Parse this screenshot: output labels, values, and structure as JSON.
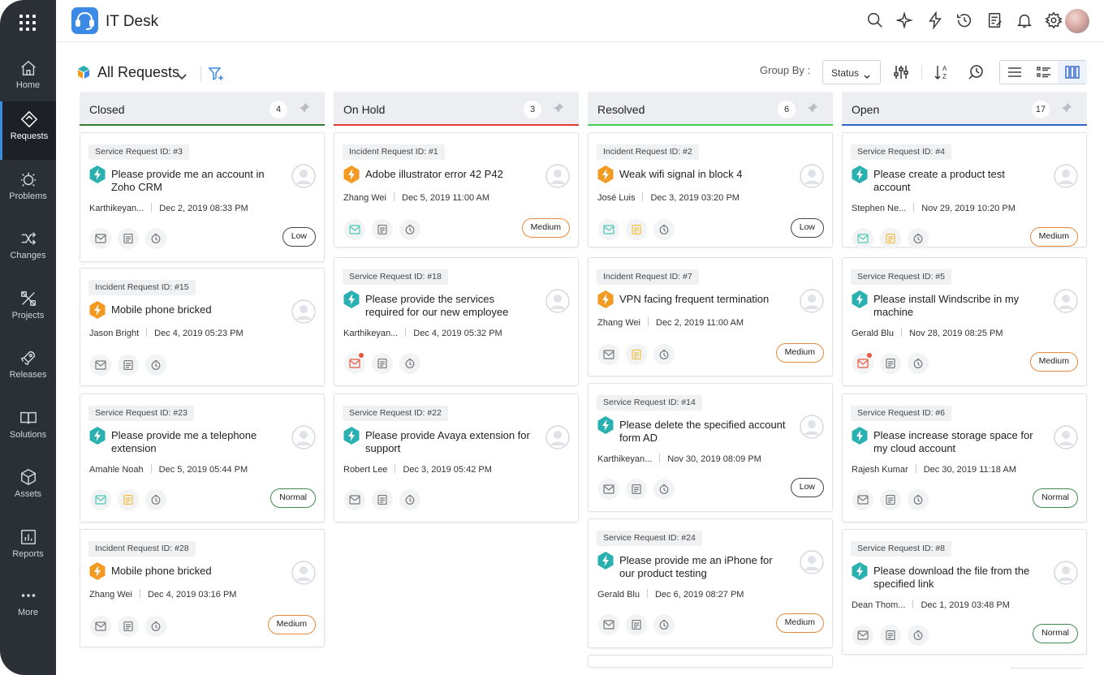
{
  "app": {
    "title": "IT Desk"
  },
  "sidebar": {
    "items": [
      {
        "label": "Home",
        "icon": "home-icon"
      },
      {
        "label": "Requests",
        "icon": "requests-icon"
      },
      {
        "label": "Problems",
        "icon": "problems-icon"
      },
      {
        "label": "Changes",
        "icon": "changes-icon"
      },
      {
        "label": "Projects",
        "icon": "projects-icon"
      },
      {
        "label": "Releases",
        "icon": "releases-icon"
      },
      {
        "label": "Solutions",
        "icon": "solutions-icon"
      },
      {
        "label": "Assets",
        "icon": "assets-icon"
      },
      {
        "label": "Reports",
        "icon": "reports-icon"
      },
      {
        "label": "More",
        "icon": "more-icon"
      }
    ]
  },
  "toolbar": {
    "view_title": "All Requests",
    "group_by_label": "Group By :",
    "group_by_value": "Status"
  },
  "colors": {
    "closed": "#2e7d32",
    "on_hold": "#e53935",
    "resolved": "#43d15a",
    "open": "#2f63c9",
    "service_icon": "#2ab0b0",
    "incident_icon": "#f29a22"
  },
  "columns": [
    {
      "title": "Closed",
      "count": "4",
      "cards": [
        {
          "type": "service",
          "id_label": "Service Request ID: #3",
          "subject": "Please provide me an account in Zoho CRM",
          "requester": "Karthikeyan...",
          "date": "Dec 2, 2019 08:33 PM",
          "priority": "Low",
          "mail": "gray",
          "note": "gray"
        },
        {
          "type": "incident",
          "id_label": "Incident Request ID: #15",
          "subject": "Mobile phone bricked",
          "requester": "Jason Bright",
          "date": "Dec 4, 2019 05:23 PM",
          "priority": "",
          "mail": "gray",
          "note": "gray"
        },
        {
          "type": "service",
          "id_label": "Service Request ID: #23",
          "subject": "Please provide me a telephone extension",
          "requester": "Amahle Noah",
          "date": "Dec 5, 2019 05:44 PM",
          "priority": "Normal",
          "mail": "teal",
          "note": "yellow"
        },
        {
          "type": "incident",
          "id_label": "Incident Request ID: #28",
          "subject": "Mobile phone bricked",
          "requester": "Zhang Wei",
          "date": "Dec 4, 2019 03:16 PM",
          "priority": "Medium",
          "mail": "gray",
          "note": "gray"
        }
      ]
    },
    {
      "title": "On Hold",
      "count": "3",
      "cards": [
        {
          "type": "incident",
          "id_label": "Incident Request ID: #1",
          "subject": "Adobe illustrator error 42 P42",
          "requester": "Zhang Wei",
          "date": "Dec 5, 2019 11:00 AM",
          "priority": "Medium",
          "mail": "teal",
          "note": "gray"
        },
        {
          "type": "service",
          "id_label": "Service Request ID: #18",
          "subject": "Please provide the services required for our new employee",
          "requester": "Karthikeyan...",
          "date": "Dec 4, 2019 05:32 PM",
          "priority": "",
          "mail": "red",
          "note": "gray"
        },
        {
          "type": "service",
          "id_label": "Service Request ID: #22",
          "subject": "Please provide Avaya extension for support",
          "requester": "Robert Lee",
          "date": "Dec 3, 2019 05:42 PM",
          "priority": "",
          "mail": "gray",
          "note": "gray"
        }
      ]
    },
    {
      "title": "Resolved",
      "count": "6",
      "cards": [
        {
          "type": "incident",
          "id_label": "Incident Request ID: #2",
          "subject": "Weak wifi signal in block 4",
          "requester": "José Luis",
          "date": "Dec 3, 2019 03:20 PM",
          "priority": "Low",
          "mail": "teal",
          "note": "yellow"
        },
        {
          "type": "incident",
          "id_label": "Incident Request ID: #7",
          "subject": "VPN facing frequent termination",
          "requester": "Zhang Wei",
          "date": "Dec 2, 2019 11:00 AM",
          "priority": "Medium",
          "mail": "gray",
          "note": "yellow"
        },
        {
          "type": "service",
          "id_label": "Service Request ID: #14",
          "subject": "Please delete the specified account form AD",
          "requester": "Karthikeyan...",
          "date": "Nov 30, 2019 08:09 PM",
          "priority": "Low",
          "mail": "gray",
          "note": "gray"
        },
        {
          "type": "service",
          "id_label": "Service Request ID: #24",
          "subject": "Please provide me an iPhone for our product testing",
          "requester": "Gerald Blu",
          "date": "Dec 6, 2019 08:27 PM",
          "priority": "Medium",
          "mail": "gray",
          "note": "gray"
        }
      ]
    },
    {
      "title": "Open",
      "count": "17",
      "cards": [
        {
          "type": "service",
          "id_label": "Service Request ID: #4",
          "subject": "Please create a product test account",
          "requester": "Stephen Ne...",
          "date": "Nov 29, 2019 10:20 PM",
          "priority": "Medium",
          "mail": "teal",
          "note": "yellow"
        },
        {
          "type": "service",
          "id_label": "Service Request ID: #5",
          "subject": "Please install Windscribe in my machine",
          "requester": "Gerald Blu",
          "date": "Nov 28, 2019 08:25 PM",
          "priority": "Medium",
          "mail": "red",
          "note": "gray"
        },
        {
          "type": "service",
          "id_label": "Service Request ID: #6",
          "subject": "Please increase storage space for my cloud account",
          "requester": "Rajesh Kumar",
          "date": "Dec 30, 2019 11:18 AM",
          "priority": "Normal",
          "mail": "gray",
          "note": "gray"
        },
        {
          "type": "service",
          "id_label": "Service Request ID: #8",
          "subject": "Please download the file from the specified link",
          "requester": "Dean Thom...",
          "date": "Dec 1, 2019 03:48 PM",
          "priority": "Normal",
          "mail": "gray",
          "note": "gray"
        }
      ]
    }
  ]
}
